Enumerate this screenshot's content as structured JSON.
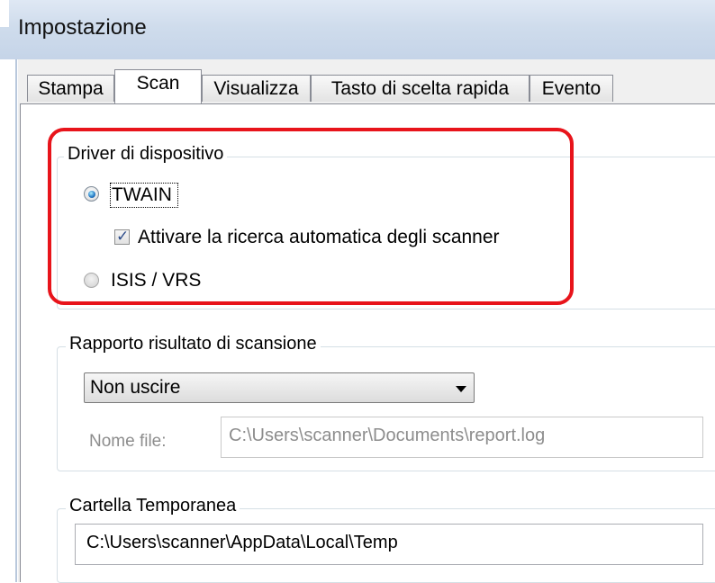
{
  "window": {
    "title": "Impostazione"
  },
  "tabs": [
    {
      "label": "Stampa",
      "active": false
    },
    {
      "label": "Scan",
      "active": true
    },
    {
      "label": "Visualizza",
      "active": false
    },
    {
      "label": "Tasto di scelta rapida",
      "active": false
    },
    {
      "label": "Evento",
      "active": false
    }
  ],
  "device_driver": {
    "title": "Driver di dispositivo",
    "twain_label": "TWAIN",
    "twain_selected": true,
    "auto_search_label": "Attivare la ricerca automatica degli scanner",
    "auto_search_checked": true,
    "isis_label": "ISIS / VRS",
    "isis_selected": false
  },
  "scan_report": {
    "title": "Rapporto risultato di scansione",
    "dropdown_value": "Non uscire",
    "file_name_label": "Nome file:",
    "file_name_value": "C:\\Users\\scanner\\Documents\\report.log"
  },
  "temp_folder": {
    "title": "Cartella Temporanea",
    "path": "C:\\Users\\scanner\\AppData\\Local\\Temp"
  },
  "highlight_color": "#e8141b"
}
